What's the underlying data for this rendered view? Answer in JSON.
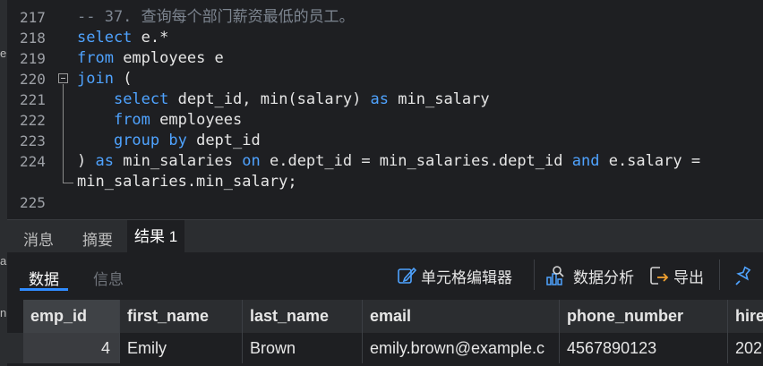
{
  "left_strip": {
    "chars": [
      "e",
      "a",
      "n"
    ]
  },
  "editor": {
    "lines": [
      {
        "num": "217",
        "parts": [
          {
            "t": "-- 37. 查询每个部门薪资最低的员工。",
            "c": "cm"
          }
        ]
      },
      {
        "num": "218",
        "parts": [
          {
            "t": "select",
            "c": "kw"
          },
          {
            "t": " e.*",
            "c": "id"
          }
        ]
      },
      {
        "num": "219",
        "parts": [
          {
            "t": "from",
            "c": "kw"
          },
          {
            "t": " employees e",
            "c": "id"
          }
        ]
      },
      {
        "num": "220",
        "parts": [
          {
            "t": "join",
            "c": "kw"
          },
          {
            "t": " (",
            "c": "id"
          }
        ]
      },
      {
        "num": "221",
        "parts": [
          {
            "t": "    ",
            "c": "id"
          },
          {
            "t": "select",
            "c": "kw"
          },
          {
            "t": " dept_id, min(salary) ",
            "c": "id"
          },
          {
            "t": "as",
            "c": "kw"
          },
          {
            "t": " min_salary",
            "c": "id"
          }
        ]
      },
      {
        "num": "222",
        "parts": [
          {
            "t": "    ",
            "c": "id"
          },
          {
            "t": "from",
            "c": "kw"
          },
          {
            "t": " employees",
            "c": "id"
          }
        ]
      },
      {
        "num": "223",
        "parts": [
          {
            "t": "    ",
            "c": "id"
          },
          {
            "t": "group by",
            "c": "kw"
          },
          {
            "t": " dept_id",
            "c": "id"
          }
        ]
      },
      {
        "num": "224",
        "parts": [
          {
            "t": ") ",
            "c": "id"
          },
          {
            "t": "as",
            "c": "kw"
          },
          {
            "t": " min_salaries ",
            "c": "id"
          },
          {
            "t": "on",
            "c": "kw"
          },
          {
            "t": " e.dept_id = min_salaries.dept_id ",
            "c": "id"
          },
          {
            "t": "and",
            "c": "kw"
          },
          {
            "t": " e.salary =",
            "c": "id"
          }
        ]
      },
      {
        "num": "",
        "parts": [
          {
            "t": "min_salaries.min_salary;",
            "c": "id"
          }
        ]
      },
      {
        "num": "225",
        "parts": []
      }
    ]
  },
  "tabs": {
    "messages": "消息",
    "summary": "摘要",
    "result": "结果 1"
  },
  "subtabs": {
    "data": "数据",
    "info": "信息"
  },
  "toolbar": {
    "cell_editor": "单元格编辑器",
    "data_analysis": "数据分析",
    "export": "导出"
  },
  "grid": {
    "columns": [
      "emp_id",
      "first_name",
      "last_name",
      "email",
      "phone_number",
      "hire"
    ],
    "rows": [
      [
        "4",
        "Emily",
        "Brown",
        "emily.brown@example.c",
        "4567890123",
        "202"
      ]
    ]
  },
  "colors": {
    "keyword": "#4fa3ff",
    "accent": "#2f8bff",
    "background": "#1e1f22"
  }
}
